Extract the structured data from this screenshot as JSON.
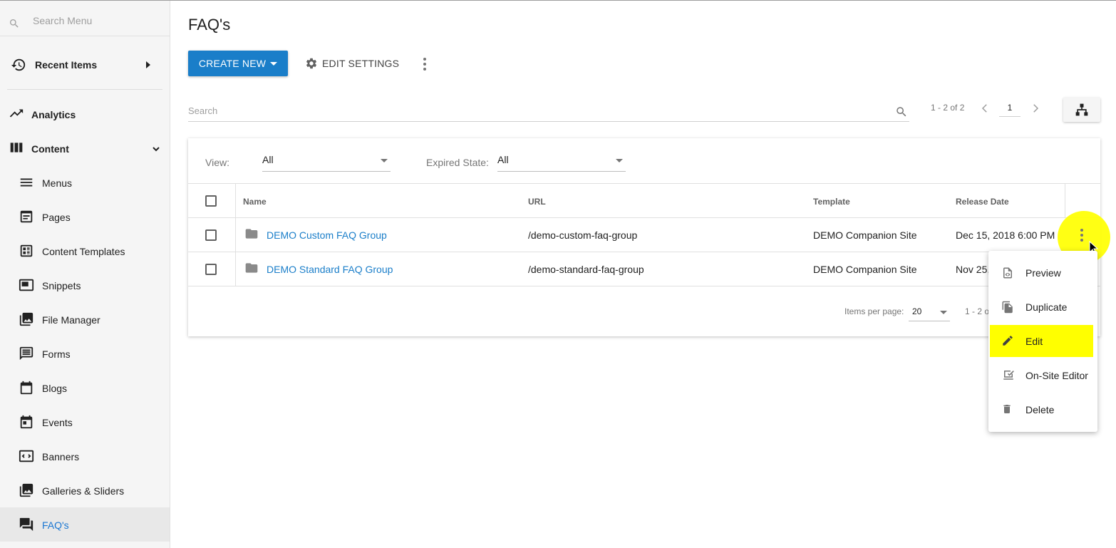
{
  "sidebar": {
    "search_placeholder": "Search Menu",
    "recent_items": "Recent Items",
    "analytics": "Analytics",
    "content": "Content",
    "items": [
      {
        "label": "Menus",
        "icon": "menu-icon"
      },
      {
        "label": "Pages",
        "icon": "pages-icon"
      },
      {
        "label": "Content Templates",
        "icon": "content-templates-icon"
      },
      {
        "label": "Snippets",
        "icon": "snippets-icon"
      },
      {
        "label": "File Manager",
        "icon": "file-manager-icon"
      },
      {
        "label": "Forms",
        "icon": "forms-icon"
      },
      {
        "label": "Blogs",
        "icon": "blogs-icon"
      },
      {
        "label": "Events",
        "icon": "events-icon"
      },
      {
        "label": "Banners",
        "icon": "banners-icon"
      },
      {
        "label": "Galleries & Sliders",
        "icon": "galleries-icon"
      },
      {
        "label": "FAQ's",
        "icon": "faq-icon",
        "active": true
      }
    ]
  },
  "header": {
    "title": "FAQ's",
    "create_new": "CREATE NEW",
    "edit_settings": "EDIT SETTINGS"
  },
  "search": {
    "placeholder": "Search"
  },
  "pager": {
    "range": "1 - 2 of 2",
    "page": "1"
  },
  "filters": {
    "view_label": "View:",
    "view_value": "All",
    "expired_label": "Expired State:",
    "expired_value": "All"
  },
  "table": {
    "headers": {
      "name": "Name",
      "url": "URL",
      "template": "Template",
      "release_date": "Release Date"
    },
    "rows": [
      {
        "name": "DEMO Custom FAQ Group",
        "url": "/demo-custom-faq-group",
        "template": "DEMO Companion Site",
        "release_date": "Dec 15, 2018 6:00 PM"
      },
      {
        "name": "DEMO Standard FAQ Group",
        "url": "/demo-standard-faq-group",
        "template": "DEMO Companion Site",
        "release_date": "Nov 25,"
      }
    ]
  },
  "footer": {
    "items_per_page_label": "Items per page:",
    "items_per_page_value": "20",
    "range": "1 - 2 o"
  },
  "context_menu": {
    "items": [
      {
        "label": "Preview",
        "icon": "preview-icon"
      },
      {
        "label": "Duplicate",
        "icon": "duplicate-icon"
      },
      {
        "label": "Edit",
        "icon": "pencil-icon",
        "highlighted": true
      },
      {
        "label": "On-Site Editor",
        "icon": "on-site-editor-icon"
      },
      {
        "label": "Delete",
        "icon": "trash-icon"
      }
    ]
  },
  "colors": {
    "accent": "#1a7ec9",
    "highlight": "#ffff00",
    "sidebar_bg": "#f5f5f5"
  }
}
